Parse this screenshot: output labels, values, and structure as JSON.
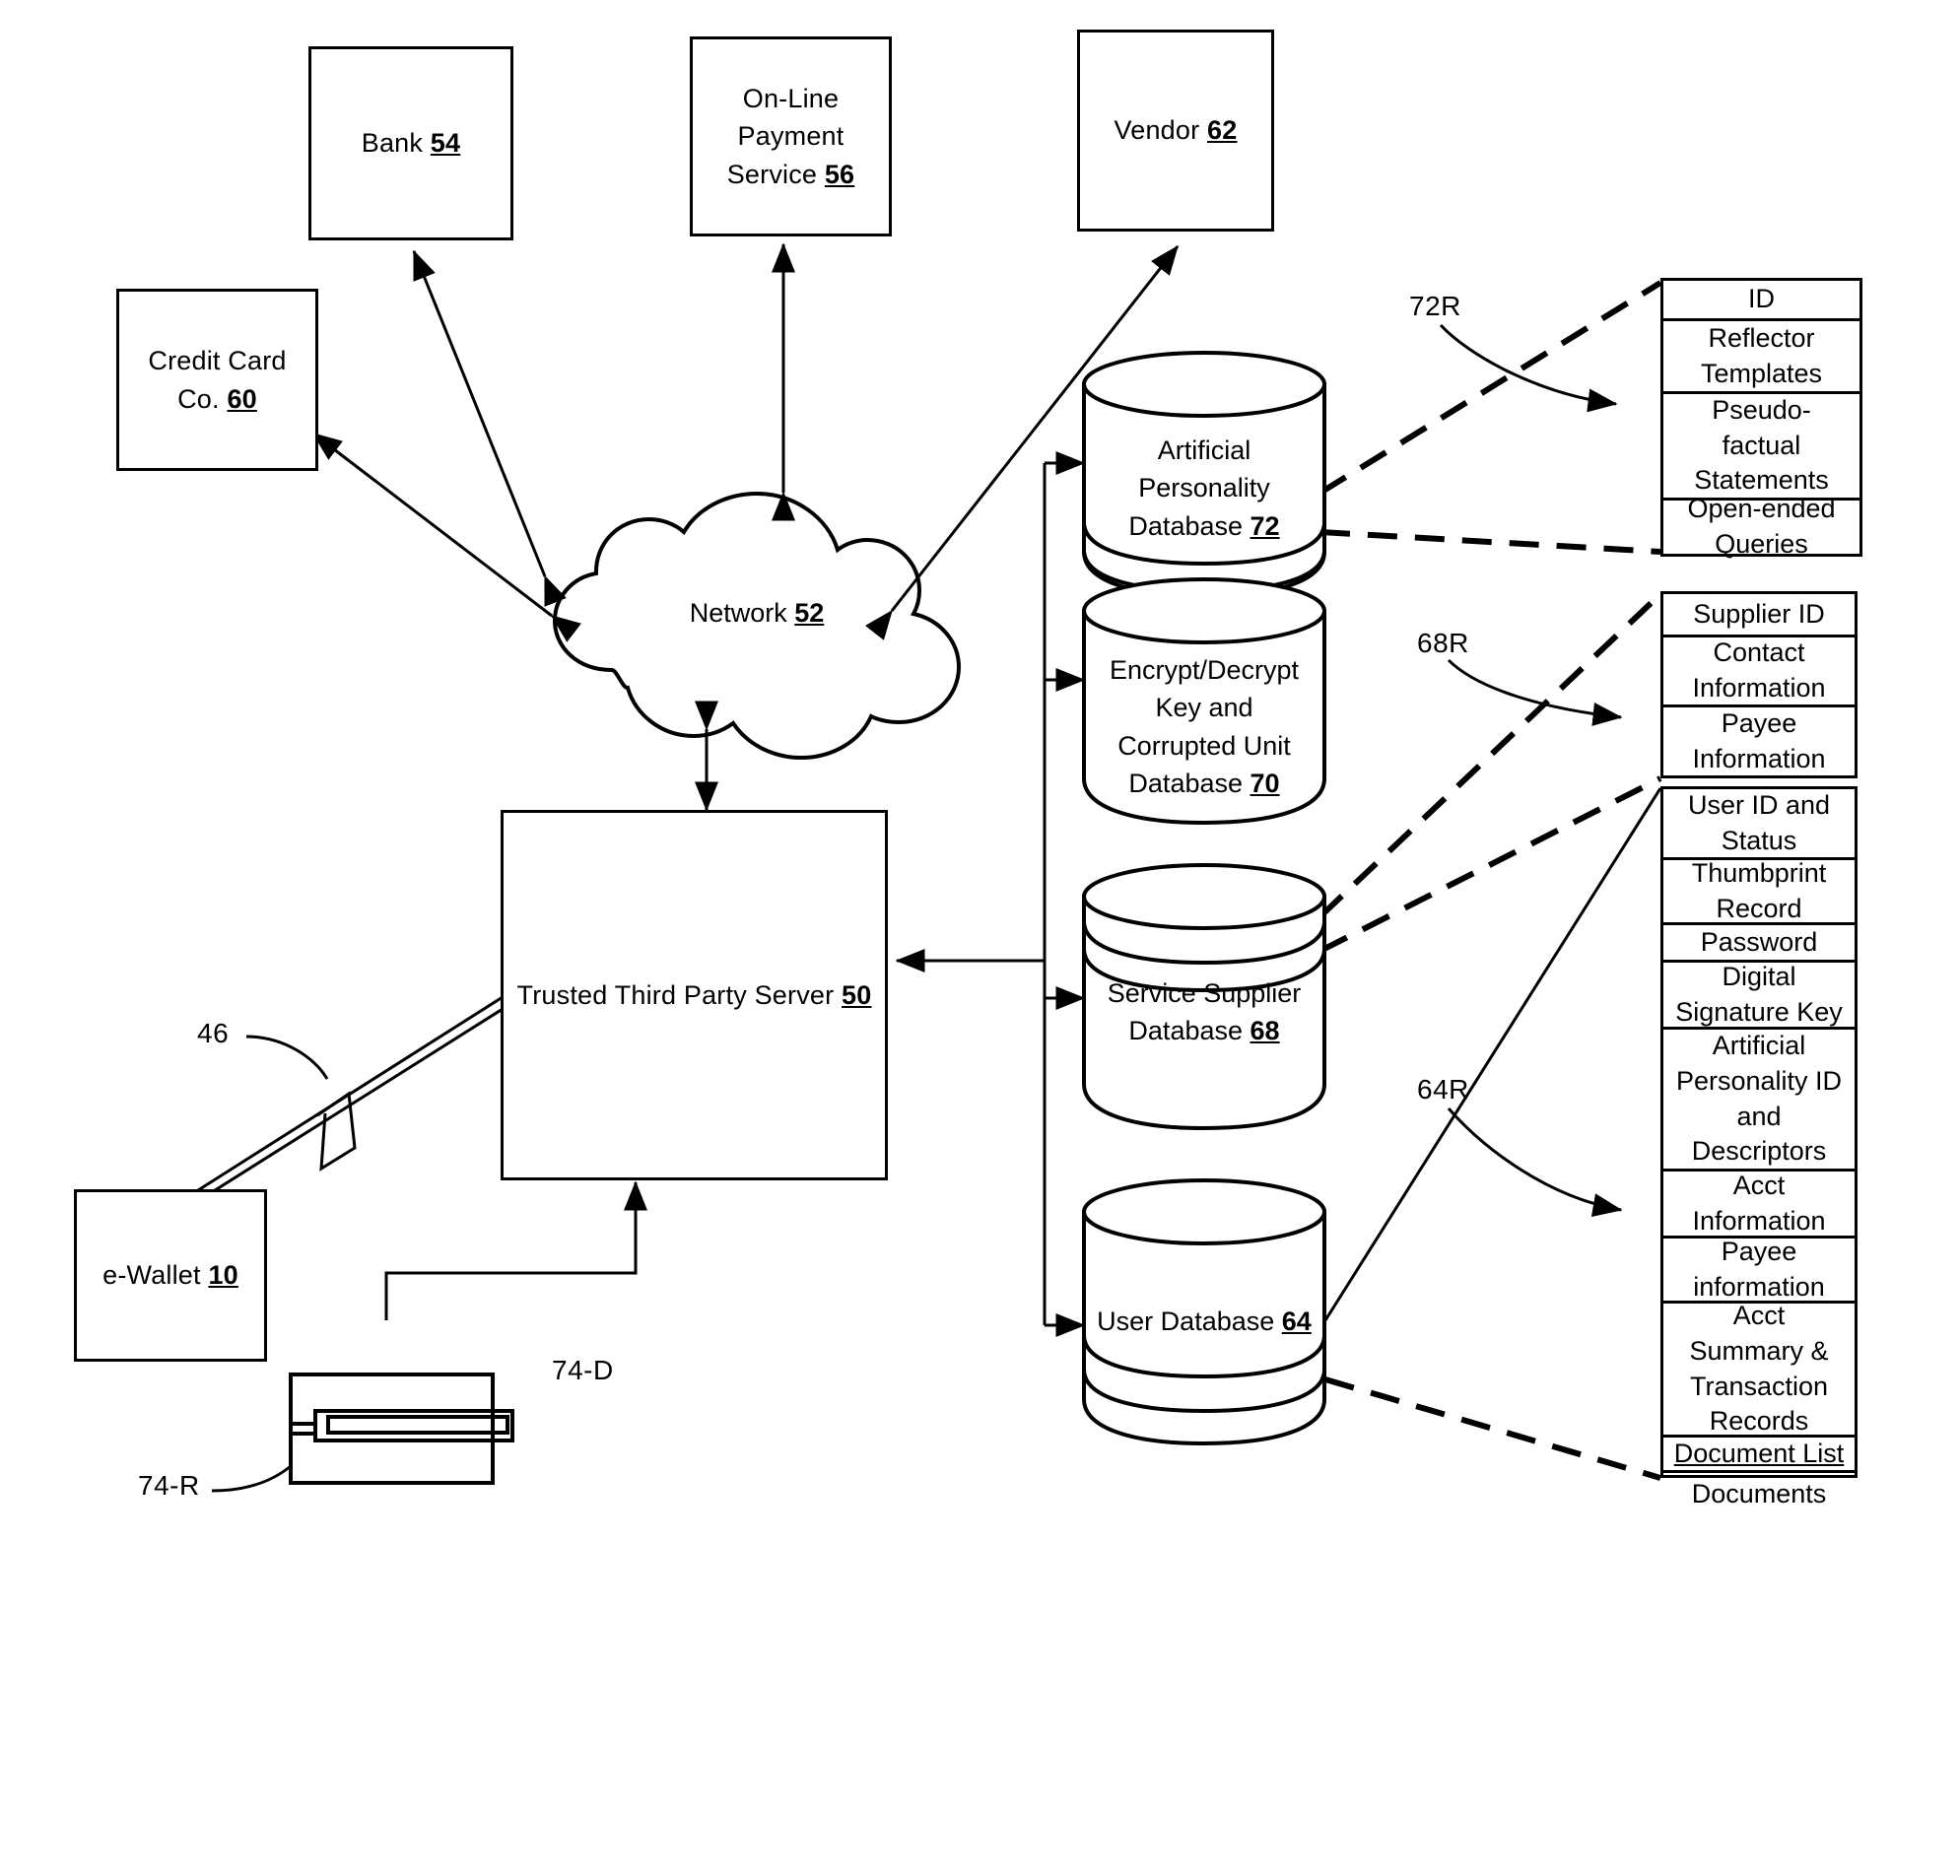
{
  "figure": {
    "type": "patent-system-diagram",
    "background": "#ffffff",
    "ink": "#000000"
  },
  "nodes": {
    "bank": {
      "label": "Bank",
      "ref": "54"
    },
    "online_payment": {
      "line1": "On-Line",
      "line2": "Payment",
      "line3": "Service",
      "ref": "56"
    },
    "vendor": {
      "label": "Vendor",
      "ref": "62"
    },
    "credit_card": {
      "line1": "Credit Card",
      "line2": "Co.",
      "ref": "60"
    },
    "network": {
      "label": "Network",
      "ref": "52"
    },
    "server": {
      "label": "Trusted Third Party Server",
      "ref": "50"
    },
    "ewallet": {
      "label": "e-Wallet",
      "ref": "10"
    }
  },
  "databases": [
    {
      "id": "ap",
      "line1": "Artificial",
      "line2": "Personality",
      "line3": "Database",
      "ref": "72"
    },
    {
      "id": "key",
      "line1": "Encrypt/Decrypt",
      "line2": "Key and",
      "line3": "Corrupted Unit",
      "line4": "Database",
      "ref": "70"
    },
    {
      "id": "supplier",
      "line1": "Service Supplier",
      "line2": "Database",
      "ref": "68"
    },
    {
      "id": "user",
      "line1": "User Database",
      "ref": "64"
    }
  ],
  "record_tables": {
    "t72R": {
      "callout": "72R",
      "rows": [
        "ID",
        "Reflector\nTemplates",
        "Pseudo-\nfactual\nStatements",
        "Open-ended\nQueries"
      ]
    },
    "t68R": {
      "callout": "68R",
      "rows": [
        "Supplier ID",
        "Contact\nInformation",
        "Payee\nInformation"
      ]
    },
    "t64R": {
      "callout": "64R",
      "rows": [
        "User ID and\nStatus",
        "Thumbprint\nRecord",
        "Password",
        "Digital\nSignature Key",
        "Artificial\nPersonality ID\nand\nDescriptors",
        "Acct\nInformation",
        "Payee\ninformation",
        "Acct\nSummary &\nTransaction\nRecords",
        "Document List",
        "Documents"
      ],
      "underlined_rows": [
        8
      ]
    }
  },
  "callouts": {
    "wireless_link": "46",
    "reader": "74-R",
    "document": "74-D"
  }
}
